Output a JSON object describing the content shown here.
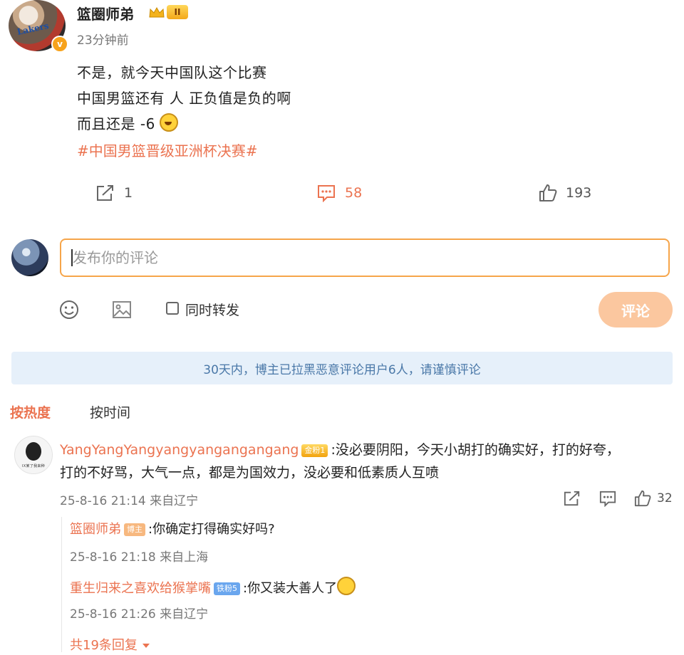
{
  "post": {
    "author": "篮圈师弟",
    "level": "II",
    "time": "23分钟前",
    "lines": [
      "不是，就今天中国队这个比赛",
      "中国男篮还有 人 正负值是负的啊",
      "而且还是 -6"
    ],
    "hashtag": "#中国男篮晋级亚洲杯决赛#",
    "avatar_jersey": "Lakers",
    "verified_mark": "v",
    "actions": {
      "repost_count": "1",
      "comment_count": "58",
      "like_count": "193"
    }
  },
  "composer": {
    "placeholder": "发布你的评论",
    "repost_label": "同时转发",
    "submit_label": "评论"
  },
  "notice": "30天内，博主已拉黑恶意评论用户6人，请谨慎评论",
  "sort": {
    "hot": "按热度",
    "time": "按时间"
  },
  "comment": {
    "author": "YangYangYangyangyangangangang",
    "badge": "金粉1",
    "text_line1": ":没必要阴阳，今天小胡打的确实好，打的好夸，",
    "text_line2": "打的不好骂，大气一点，都是为国效力，没必要和低素质人互喷",
    "meta": "25-8-16 21:14 来自辽宁",
    "like_count": "32",
    "avatar_caption": "IX某了我来种"
  },
  "replies": [
    {
      "author": "篮圈师弟",
      "badge": "博主",
      "text": ":你确定打得确实好吗?",
      "meta": "25-8-16 21:18 来自上海"
    },
    {
      "author": "重生归来之喜欢给猴掌嘴",
      "badge": "铁粉5",
      "text": ":你又装大善人了",
      "meta": "25-8-16 21:26 来自辽宁"
    }
  ],
  "more_replies": "共19条回复",
  "colors": {
    "accent": "#eb7350",
    "notice_bg": "#e6f0fa",
    "notice_text": "#4a78a8",
    "input_border": "#f6a54a",
    "submit_bg": "#fbc79f"
  }
}
